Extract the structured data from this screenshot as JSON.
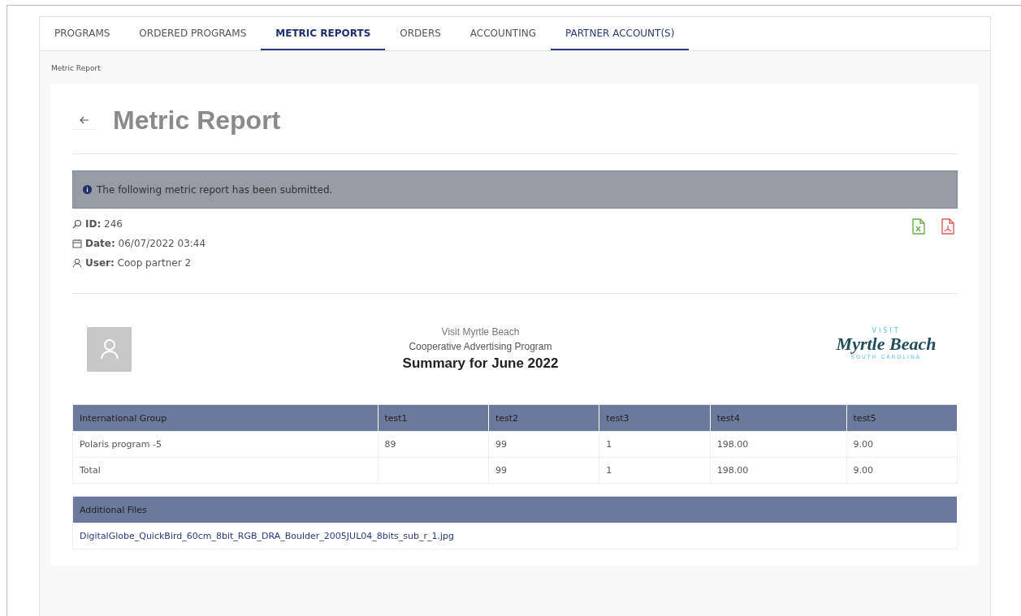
{
  "tabs": [
    {
      "label": "PROGRAMS",
      "selected": false,
      "underlined": false
    },
    {
      "label": "ORDERED PROGRAMS",
      "selected": false,
      "underlined": false
    },
    {
      "label": "METRIC REPORTS",
      "selected": true,
      "underlined": true
    },
    {
      "label": "ORDERS",
      "selected": false,
      "underlined": false
    },
    {
      "label": "ACCOUNTING",
      "selected": false,
      "underlined": false
    },
    {
      "label": "PARTNER ACCOUNT(S)",
      "selected": false,
      "underlined": true
    }
  ],
  "breadcrumb": "Metric Report",
  "title": "Metric Report",
  "alert": "The following metric report has been submitted.",
  "meta": [
    {
      "kind": "id",
      "label": "ID:",
      "value": "246"
    },
    {
      "kind": "date",
      "label": "Date:",
      "value": "06/07/2022 03:44"
    },
    {
      "kind": "user",
      "label": "User:",
      "value": "Coop partner 2"
    }
  ],
  "report_header": {
    "org": "Visit Myrtle Beach",
    "program": "Cooperative Advertising Program",
    "summary": "Summary for June 2022"
  },
  "logo": {
    "top": "VISIT",
    "name": "Myrtle Beach",
    "bottom": "SOUTH CAROLINA"
  },
  "table": {
    "columns": [
      "International Group",
      "test1",
      "test2",
      "test3",
      "test4",
      "test5"
    ],
    "rows": [
      [
        "Polaris program -5",
        "89",
        "99",
        "1",
        "198.00",
        "9.00"
      ],
      [
        "Total",
        "",
        "99",
        "1",
        "198.00",
        "9.00"
      ]
    ]
  },
  "files": {
    "heading": "Additional Files",
    "items": [
      "DigitalGlobe_QuickBird_60cm_8bit_RGB_DRA_Boulder_2005JUL04_8bits_sub_r_1.jpg"
    ]
  }
}
